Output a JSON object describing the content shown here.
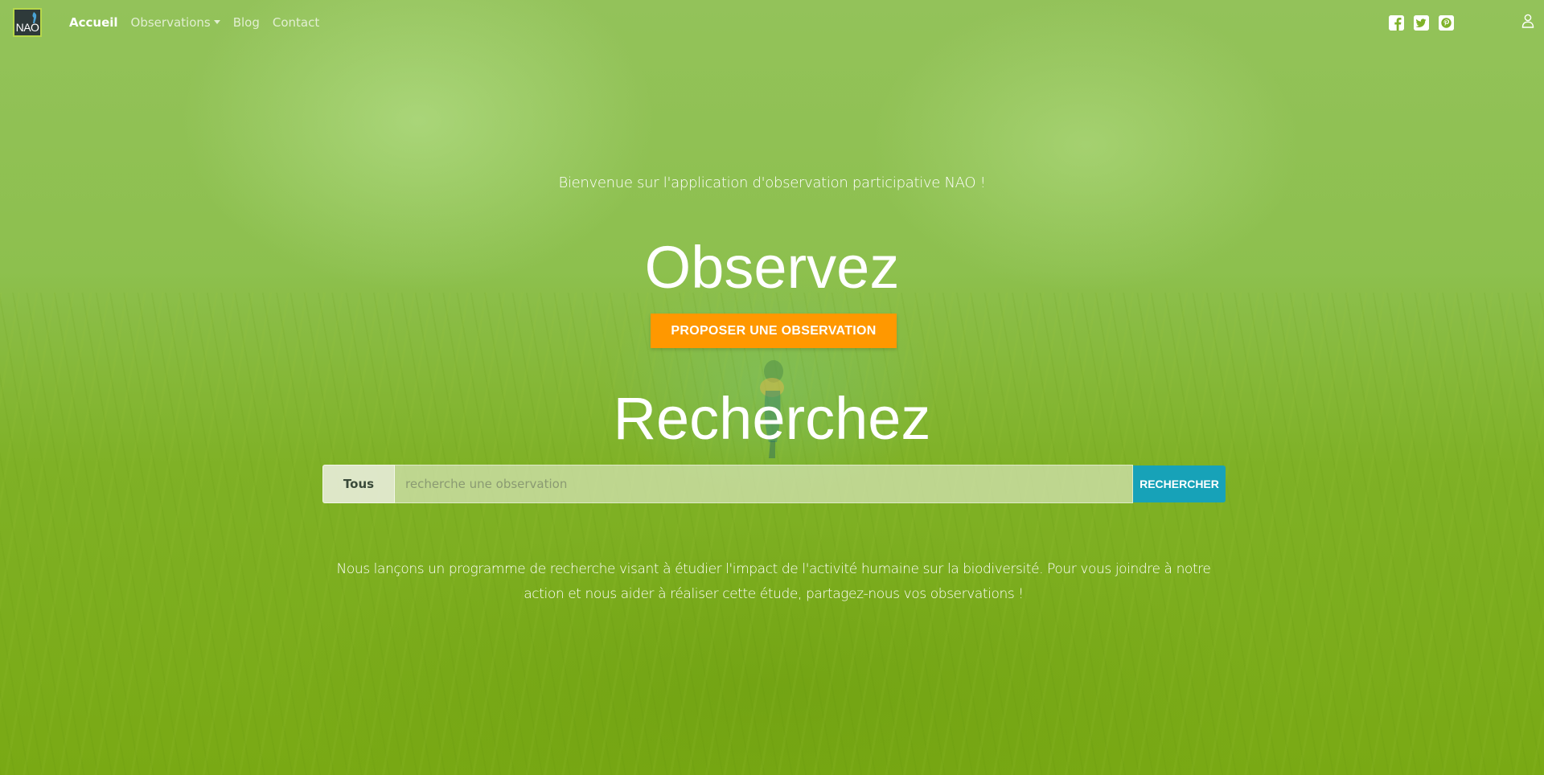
{
  "nav": {
    "logo_text": "NAO",
    "links": [
      {
        "label": "Accueil",
        "active": true
      },
      {
        "label": "Observations",
        "dropdown": true
      },
      {
        "label": "Blog"
      },
      {
        "label": "Contact"
      }
    ],
    "social_icons": [
      "facebook-icon",
      "twitter-icon",
      "pinterest-icon"
    ],
    "user_icon": "user-icon"
  },
  "hero": {
    "welcome": "Bienvenue sur l'application d'observation participative NAO !",
    "observe_heading": "Observez",
    "propose_button": "PROPOSER UNE OBSERVATION",
    "search_heading": "Recherchez",
    "description": "Nous lançons un programme de recherche visant à étudier l'impact de l'activité humaine sur la biodiversité. Pour vous joindre à notre action et nous aider à réaliser cette étude, partagez-nous vos observations !"
  },
  "search": {
    "filter_value": "Tous",
    "placeholder": "recherche une observation",
    "button_label": "RECHERCHER"
  },
  "colors": {
    "accent_orange": "#ff9800",
    "search_button": "#17a2b8",
    "background_green": "#7fb22a"
  }
}
